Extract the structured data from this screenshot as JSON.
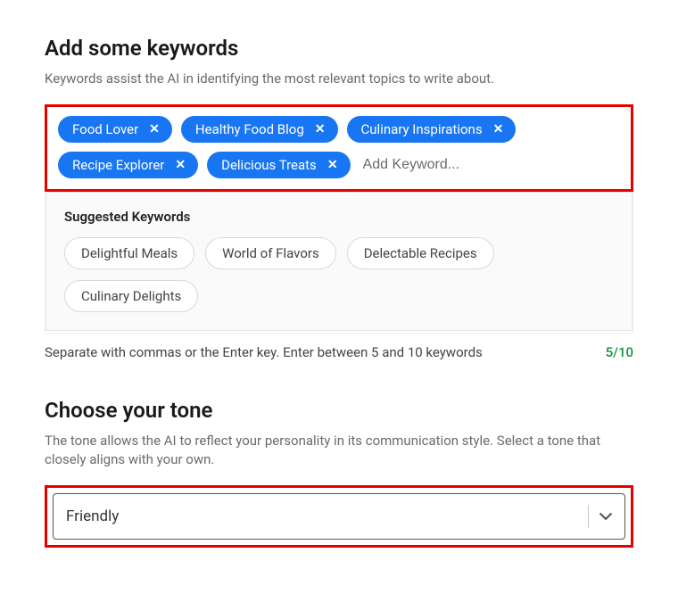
{
  "keywords_section": {
    "heading": "Add some keywords",
    "description": "Keywords assist the AI in identifying the most relevant topics to write about.",
    "tags": [
      {
        "label": "Food Lover"
      },
      {
        "label": "Healthy Food Blog"
      },
      {
        "label": "Culinary Inspirations"
      },
      {
        "label": "Recipe Explorer"
      },
      {
        "label": "Delicious Treats"
      }
    ],
    "add_placeholder": "Add Keyword...",
    "suggested_title": "Suggested Keywords",
    "suggested": [
      {
        "label": "Delightful Meals"
      },
      {
        "label": "World of Flavors"
      },
      {
        "label": "Delectable Recipes"
      },
      {
        "label": "Culinary Delights"
      }
    ],
    "helper_text": "Separate with commas or the Enter key. Enter between 5 and 10 keywords",
    "counter": "5/10"
  },
  "tone_section": {
    "heading": "Choose your tone",
    "description": "The tone allows the AI to reflect your personality in its communication style. Select a tone that closely aligns with your own.",
    "selected": "Friendly"
  }
}
